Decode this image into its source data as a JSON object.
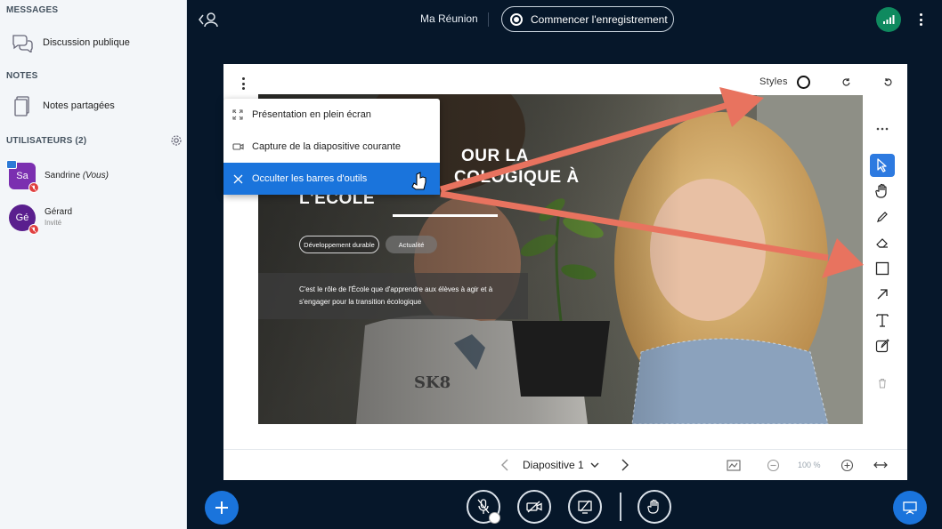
{
  "sidebar": {
    "messages_title": "MESSAGES",
    "public_chat": "Discussion publique",
    "notes_title": "NOTES",
    "shared_notes": "Notes partagées",
    "users_title": "UTILISATEURS (2)",
    "users": [
      {
        "initials": "Sa",
        "name": "Sandrine",
        "you": "(Vous)",
        "role": "",
        "color": "#7b2fb0"
      },
      {
        "initials": "Gé",
        "name": "Gérard",
        "you": "",
        "role": "Invité",
        "color": "#5a1f8e"
      }
    ]
  },
  "topbar": {
    "meeting_title": "Ma Réunion",
    "record_label": "Commencer l'enregistrement"
  },
  "presentation": {
    "styles_label": "Styles",
    "menu": [
      {
        "label": "Présentation en plein écran",
        "icon": "fullscreen-icon"
      },
      {
        "label": "Capture de la diapositive courante",
        "icon": "camera-icon"
      },
      {
        "label": "Occulter les barres d'outils",
        "icon": "close-icon"
      }
    ],
    "slide": {
      "title_line1": "OUR LA",
      "title_line2": "COLOGIQUE À",
      "title_line3": "L'ÉCOLE",
      "tag1": "Développement durable",
      "tag2": "Actualité",
      "body_line1": "C'est le rôle de l'École que d'apprendre aux élèves à agir et à",
      "body_line2": "s'engager pour la transition écologique",
      "shirt_text": "SK8"
    },
    "footer": {
      "slide_label": "Diapositive 1",
      "zoom": "100 %"
    }
  },
  "colors": {
    "accent": "#1a74dc",
    "dark_bg": "#06172a",
    "annotation_arrow": "#e8735f"
  }
}
